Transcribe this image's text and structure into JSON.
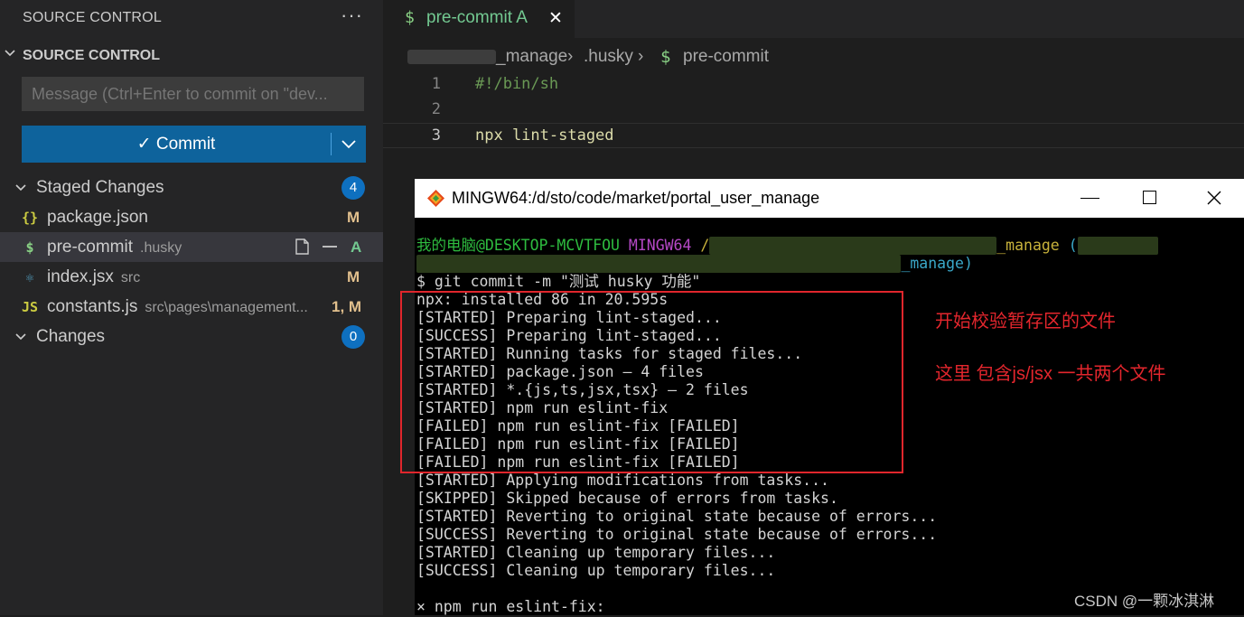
{
  "sidebar": {
    "header": "SOURCE CONTROL",
    "more_glyph": "···",
    "section_title": "SOURCE CONTROL",
    "message_placeholder": "Message (Ctrl+Enter to commit on \"dev...",
    "commit_label": "✓ Commit",
    "staged_label": "Staged Changes",
    "staged_count": "4",
    "changes_label": "Changes",
    "changes_count": "0",
    "staged_files": [
      {
        "icon": "{}",
        "icon_name": "json-file-icon",
        "icon_color": "#cbcb41",
        "name": "package.json",
        "dir": "",
        "status": "M",
        "status_color": "#e2c08d"
      },
      {
        "icon": "$",
        "icon_name": "shell-file-icon",
        "icon_color": "#89d185",
        "name": "pre-commit",
        "dir": ".husky",
        "status": "A",
        "status_color": "#73c991"
      },
      {
        "icon": "⚛",
        "icon_name": "react-file-icon",
        "icon_color": "#519aba",
        "name": "index.jsx",
        "dir": "src",
        "status": "M",
        "status_color": "#e2c08d"
      },
      {
        "icon": "JS",
        "icon_name": "javascript-file-icon",
        "icon_color": "#cbcb41",
        "name": "constants.js",
        "dir": "src\\pages\\management...",
        "status": "1, M",
        "status_color": "#e2c08d"
      }
    ]
  },
  "editor": {
    "tab_label": "pre-commit A",
    "tab_icon": "$",
    "close_glyph": "✕",
    "breadcrumb": [
      "_manage",
      ".husky",
      "pre-commit"
    ],
    "breadcrumb_sep": "›",
    "lines": [
      {
        "no": "1",
        "text": "#!/bin/sh"
      },
      {
        "no": "2",
        "text": ""
      },
      {
        "no": "3",
        "text": "npx lint-staged"
      }
    ]
  },
  "terminal": {
    "title": "MINGW64:/d/sto/code/market/portal_user_manage",
    "prompt_user": "我的电脑@DESKTOP-MCVTFOU",
    "prompt_shell": "MINGW64",
    "prompt_path_end": "_manage",
    "prompt_path_end2": "_manage)",
    "command": "$ git commit -m \"测试 husky 功能\"",
    "output": [
      "npx: installed 86 in 20.595s",
      "[STARTED] Preparing lint-staged...",
      "[SUCCESS] Preparing lint-staged...",
      "[STARTED] Running tasks for staged files...",
      "[STARTED] package.json — 4 files",
      "[STARTED] *.{js,ts,jsx,tsx} — 2 files",
      "[STARTED] npm run eslint-fix",
      "[FAILED] npm run eslint-fix [FAILED]",
      "[FAILED] npm run eslint-fix [FAILED]",
      "[FAILED] npm run eslint-fix [FAILED]",
      "[STARTED] Applying modifications from tasks...",
      "[SKIPPED] Skipped because of errors from tasks.",
      "[STARTED] Reverting to original state because of errors...",
      "[SUCCESS] Reverting to original state because of errors...",
      "[STARTED] Cleaning up temporary files...",
      "[SUCCESS] Cleaning up temporary files...",
      "",
      "× npm run eslint-fix:"
    ]
  },
  "annotations": {
    "line1": "开始校验暂存区的文件",
    "line2": "这里 包含js/jsx 一共两个文件"
  },
  "watermark": "CSDN @一颗冰淇淋",
  "colors": {
    "accent": "#0e639c",
    "annotation_red": "#e3262d"
  }
}
